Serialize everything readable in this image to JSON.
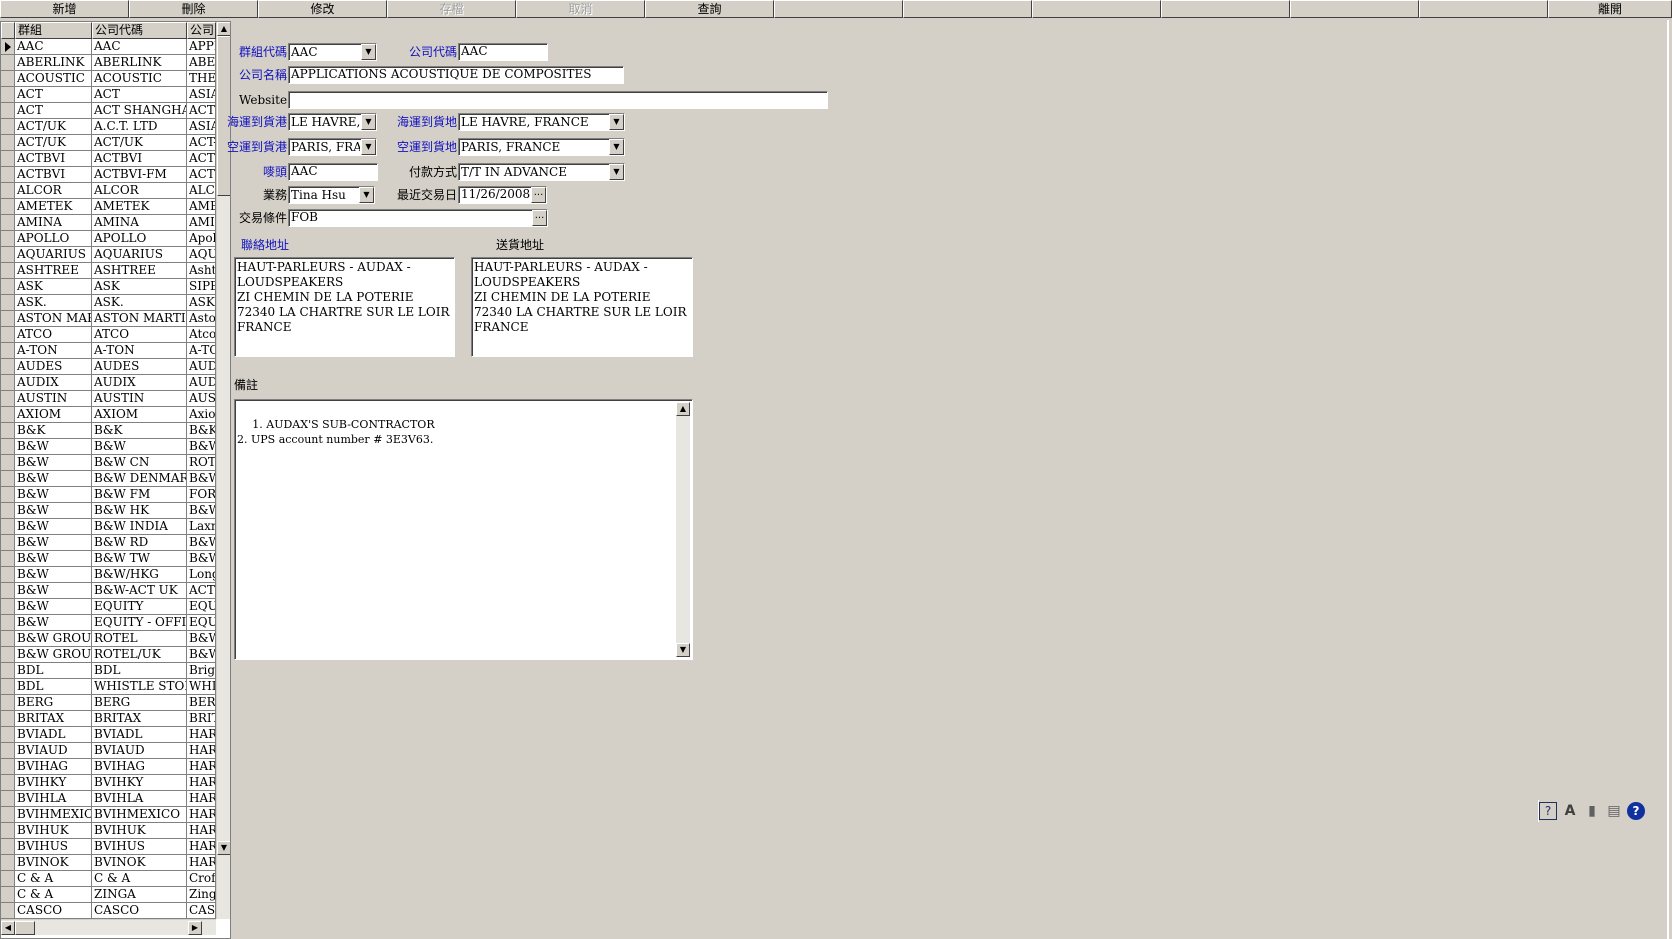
{
  "toolbar": {
    "buttons": [
      "新增",
      "刪除",
      "修改",
      "存檔",
      "取消",
      "查詢",
      "",
      "",
      "",
      "",
      "",
      "",
      "離開"
    ],
    "disabled": [
      false,
      false,
      false,
      true,
      true,
      false,
      false,
      false,
      false,
      false,
      false,
      false,
      false
    ]
  },
  "grid": {
    "headers": [
      "群組",
      "公司代碼",
      "公司"
    ],
    "rows": [
      [
        "AAC",
        "AAC",
        "APPL"
      ],
      [
        "ABERLINK",
        "ABERLINK",
        "ABEI"
      ],
      [
        "ACOUSTIC",
        "ACOUSTIC",
        "THE"
      ],
      [
        "ACT",
        "ACT",
        "ASIA"
      ],
      [
        "ACT",
        "ACT SHANGHAI",
        "ACT"
      ],
      [
        "ACT/UK",
        "A.C.T. LTD",
        "ASIA"
      ],
      [
        "ACT/UK",
        "ACT/UK",
        "ACT-"
      ],
      [
        "ACTBVI",
        "ACTBVI",
        "ACTI"
      ],
      [
        "ACTBVI",
        "ACTBVI-FM",
        "ACT"
      ],
      [
        "ALCOR",
        "ALCOR",
        "ALCO"
      ],
      [
        "AMETEK",
        "AMETEK",
        "AME"
      ],
      [
        "AMINA",
        "AMINA",
        "AMIN"
      ],
      [
        "APOLLO",
        "APOLLO",
        "Apoll"
      ],
      [
        "AQUARIUS",
        "AQUARIUS",
        "AQU."
      ],
      [
        "ASHTREE",
        "ASHTREE",
        "Ashtr"
      ],
      [
        "ASK",
        "ASK",
        "SIPE"
      ],
      [
        "ASK.",
        "ASK.",
        "ASK"
      ],
      [
        "ASTON MARTIN",
        "ASTON MARTIN",
        "Astor"
      ],
      [
        "ATCO",
        "ATCO",
        "Atco-"
      ],
      [
        "A-TON",
        "A-TON",
        "A-TC"
      ],
      [
        "AUDES",
        "AUDES",
        "AUDI"
      ],
      [
        "AUDIX",
        "AUDIX",
        "AUDI"
      ],
      [
        "AUSTIN",
        "AUSTIN",
        "AUST"
      ],
      [
        "AXIOM",
        "AXIOM",
        "Axion"
      ],
      [
        "B&K",
        "B&K",
        "B&K"
      ],
      [
        "B&W",
        "B&W",
        "B&W"
      ],
      [
        "B&W",
        "B&W CN",
        "ROTI"
      ],
      [
        "B&W",
        "B&W DENMARK",
        "B&W"
      ],
      [
        "B&W",
        "B&W FM",
        "FORI"
      ],
      [
        "B&W",
        "B&W HK",
        "B&W"
      ],
      [
        "B&W",
        "B&W INDIA",
        "Laxm"
      ],
      [
        "B&W",
        "B&W RD",
        "B&W"
      ],
      [
        "B&W",
        "B&W TW",
        "B&W"
      ],
      [
        "B&W",
        "B&W/HKG",
        "Long"
      ],
      [
        "B&W",
        "B&W-ACT UK",
        "ACT"
      ],
      [
        "B&W",
        "EQUITY",
        "EQUI"
      ],
      [
        "B&W",
        "EQUITY - OFFICE",
        "EQUI"
      ],
      [
        "B&W GROUP",
        "ROTEL",
        "B&W"
      ],
      [
        "B&W GROUP",
        "ROTEL/UK",
        "B&W"
      ],
      [
        "BDL",
        "BDL",
        "Brigh"
      ],
      [
        "BDL",
        "WHISTLE STOP",
        "WHIS"
      ],
      [
        "BERG",
        "BERG",
        "BERG"
      ],
      [
        "BRITAX",
        "BRITAX",
        "BRIT"
      ],
      [
        "BVIADL",
        "BVIADL",
        "HARI"
      ],
      [
        "BVIAUD",
        "BVIAUD",
        "HARI"
      ],
      [
        "BVIHAG",
        "BVIHAG",
        "HARI"
      ],
      [
        "BVIHKY",
        "BVIHKY",
        "HARI"
      ],
      [
        "BVIHLA",
        "BVIHLA",
        "HARI"
      ],
      [
        "BVIHMEXICO",
        "BVIHMEXICO",
        "HARI"
      ],
      [
        "BVIHUK",
        "BVIHUK",
        "HARI"
      ],
      [
        "BVIHUS",
        "BVIHUS",
        "HARI"
      ],
      [
        "BVINOK",
        "BVINOK",
        "HARI"
      ],
      [
        "C & A",
        "C & A",
        "Croft"
      ],
      [
        "C & A",
        "ZINGA",
        "Zinga"
      ],
      [
        "CASCO",
        "CASCO",
        "CASC"
      ]
    ]
  },
  "form": {
    "group_code": {
      "label": "群組代碼",
      "value": "AAC"
    },
    "company_code": {
      "label": "公司代碼",
      "value": "AAC"
    },
    "company_name": {
      "label": "公司名稱",
      "value": "APPLICATIONS ACOUSTIQUE  DE COMPOSITES"
    },
    "website": {
      "label": "Website",
      "value": ""
    },
    "sea_port": {
      "label": "海運到貨港",
      "value": "LE HAVRE, FR"
    },
    "sea_dest": {
      "label": "海運到貨地",
      "value": "LE HAVRE, FRANCE"
    },
    "air_port": {
      "label": "空運到貨港",
      "value": "PARIS, FRANC"
    },
    "air_dest": {
      "label": "空運到貨地",
      "value": "PARIS, FRANCE"
    },
    "mark": {
      "label": "嘜頭",
      "value": "AAC"
    },
    "payment": {
      "label": "付款方式",
      "value": "T/T IN ADVANCE"
    },
    "sales": {
      "label": "業務",
      "value": "Tina Hsu"
    },
    "last_trade": {
      "label": "最近交易日",
      "value": "11/26/2008"
    },
    "terms": {
      "label": "交易條件",
      "value": "FOB"
    },
    "contact_addr": {
      "label": "聯絡地址",
      "value": "HAUT-PARLEURS - AUDAX -\nLOUDSPEAKERS\nZI CHEMIN DE LA POTERIE\n72340 LA CHARTRE SUR LE LOIR\nFRANCE"
    },
    "ship_addr": {
      "label": "送貨地址",
      "value": "HAUT-PARLEURS - AUDAX -\nLOUDSPEAKERS\nZI CHEMIN DE LA POTERIE\n72340 LA CHARTRE SUR LE LOIR\nFRANCE"
    },
    "notes": {
      "label": "備註",
      "value": "1. AUDAX'S SUB-CONTRACTOR\n2. UPS account number # 3E3V63."
    }
  },
  "status_icons": [
    "help-context-icon",
    "font-icon",
    "layout-icon",
    "report-icon",
    "question-icon"
  ]
}
